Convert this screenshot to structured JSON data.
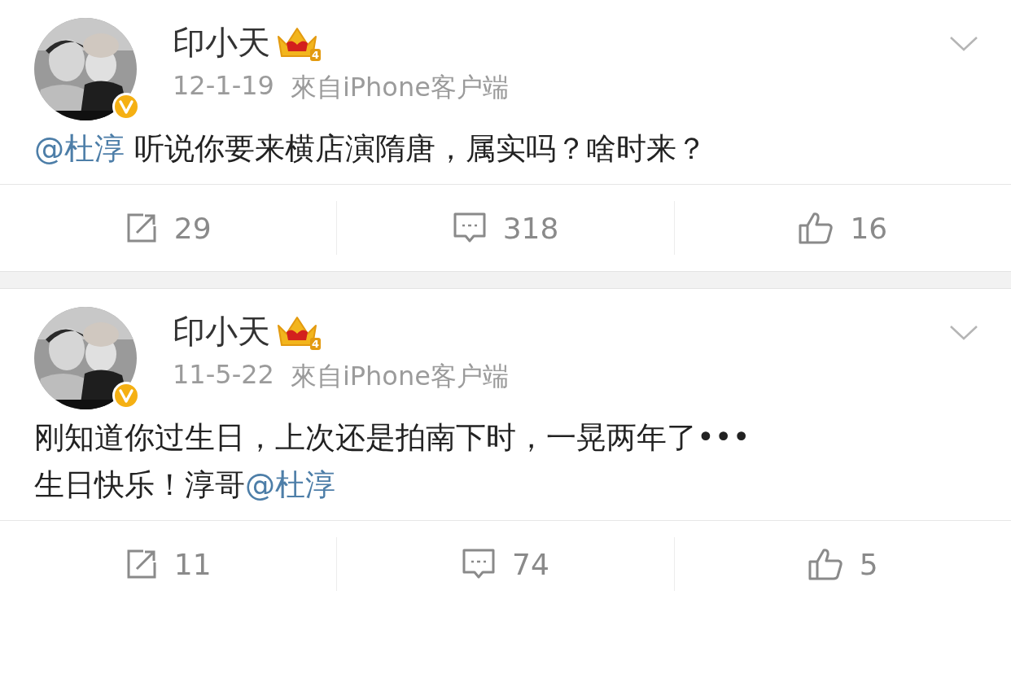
{
  "posts": [
    {
      "author": "印小天",
      "level_badge": "4",
      "time": "12-1-19",
      "source": "來自iPhone客户端",
      "avatar": {
        "kind": "picture"
      },
      "lines": [
        [
          {
            "kind": "mention",
            "text": "@杜淳"
          },
          {
            "kind": "plain",
            "text": " 听说你要来横店演隋唐，属实吗？啥时来？"
          }
        ]
      ],
      "actions": [
        {
          "kind": "repost",
          "count": "29"
        },
        {
          "kind": "comment",
          "count": "318"
        },
        {
          "kind": "like",
          "count": "16"
        }
      ]
    },
    {
      "author": "印小天",
      "level_badge": "4",
      "time": "11-5-22",
      "source": "來自iPhone客户端",
      "avatar": {
        "kind": "picture"
      },
      "lines": [
        [
          {
            "kind": "plain",
            "text": "刚知道你过生日，上次还是拍南下时，一晃两年了•••"
          }
        ],
        [
          {
            "kind": "plain",
            "text": "生日快乐！淳哥"
          },
          {
            "kind": "mention",
            "text": "@杜淳"
          }
        ]
      ],
      "actions": [
        {
          "kind": "repost",
          "count": "11"
        },
        {
          "kind": "comment",
          "count": "74"
        },
        {
          "kind": "like",
          "count": "5"
        }
      ]
    }
  ]
}
